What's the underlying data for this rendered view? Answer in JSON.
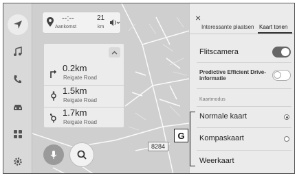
{
  "rail": {
    "items": [
      {
        "icon": "navigation-arrow-icon",
        "active": true
      },
      {
        "icon": "music-note-icon"
      },
      {
        "icon": "phone-icon"
      },
      {
        "icon": "car-icon"
      },
      {
        "icon": "apps-grid-icon"
      },
      {
        "icon": "settings-gear-icon"
      }
    ]
  },
  "nav": {
    "eta": "--:--",
    "arrival_label": "Aankomst",
    "distance_value": "21",
    "distance_unit": "km"
  },
  "turns": [
    {
      "distance": "0.2km",
      "road": "Reigate Road",
      "icon": "turn-right-icon"
    },
    {
      "distance": "1.5km",
      "road": "Reigate Road",
      "icon": "roundabout-icon"
    },
    {
      "distance": "1.7km",
      "road": "Reigate Road",
      "icon": "turn-left-roundabout-icon"
    }
  ],
  "map": {
    "road_label": "8284",
    "callout_letter": "G"
  },
  "panel": {
    "close": "×",
    "tabs": [
      "Interessante plaatsen",
      "Kaart tonen"
    ],
    "active_tab": 1,
    "speed_camera_label": "Flitscamera",
    "speed_camera_on": true,
    "pedi_label_line1": "Predictive Efficient Drive-",
    "pedi_label_line2": "informatie",
    "pedi_on": false,
    "map_mode_title": "Kaartmodus",
    "map_modes": [
      "Normale kaart",
      "Kompaskaart",
      "Weerkaart"
    ],
    "selected_mode": 0
  },
  "colors": {
    "rail_bg": "#d9d9d9",
    "map_bg": "#cfcfcf",
    "panel_bg": "#ebebeb",
    "toggle_on": "#666666"
  }
}
